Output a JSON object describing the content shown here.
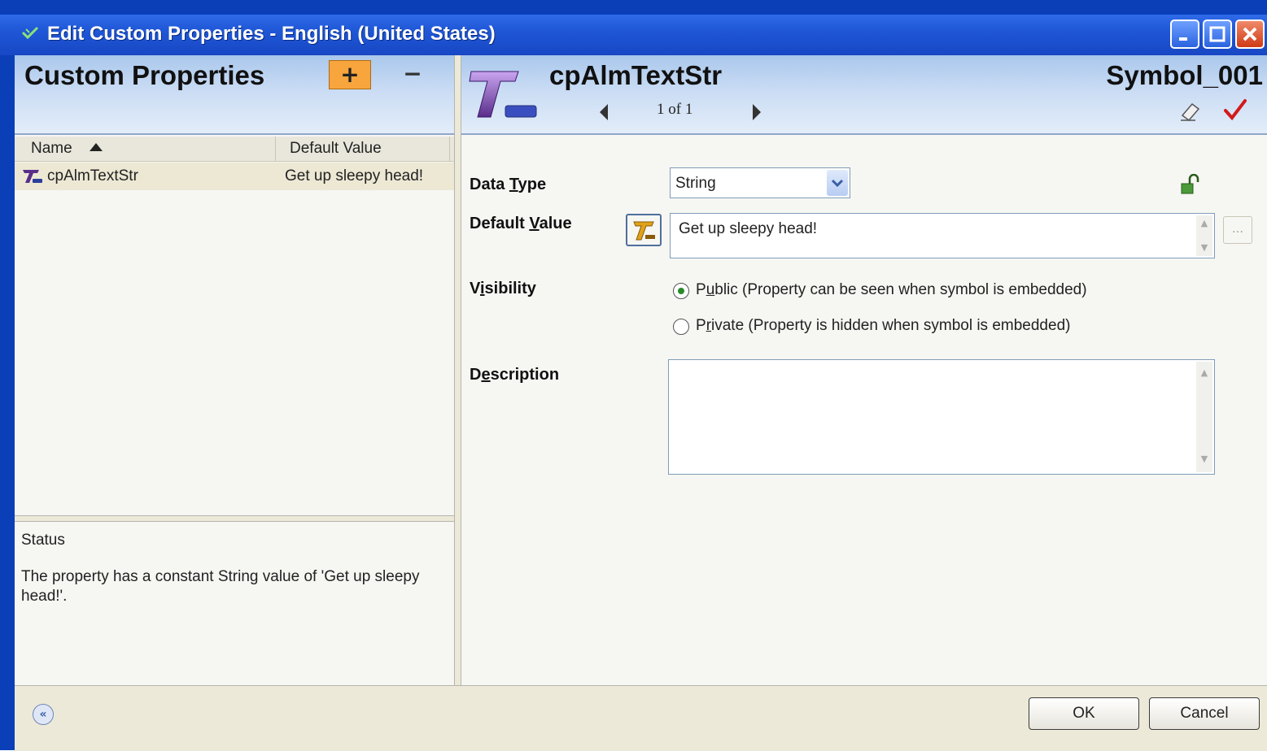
{
  "window": {
    "title": "Edit Custom Properties - English (United States)"
  },
  "left_panel": {
    "title": "Custom Properties",
    "add_label": "+",
    "remove_label": "−",
    "columns": {
      "name": "Name",
      "default_value": "Default Value"
    },
    "rows": [
      {
        "name": "cpAlmTextStr",
        "default_value": "Get up sleepy head!"
      }
    ],
    "status": {
      "title": "Status",
      "message": "The property has a constant String value of 'Get up sleepy head!'."
    }
  },
  "right_panel": {
    "property_name": "cpAlmTextStr",
    "navigation": "1 of 1",
    "symbol_name": "Symbol_001",
    "data_type": {
      "label_pre": "Data ",
      "label_key": "T",
      "label_post": "ype",
      "value": "String"
    },
    "default_value": {
      "label_pre": "Default ",
      "label_key": "V",
      "label_post": "alue",
      "value": "Get up sleepy head!"
    },
    "visibility": {
      "label_pre": "V",
      "label_key": "i",
      "label_post": "sibility",
      "options": [
        {
          "pre": "P",
          "key": "u",
          "post": "blic (Property can be seen when symbol is embedded)",
          "selected": true
        },
        {
          "pre": "P",
          "key": "r",
          "post": "ivate (Property is hidden when symbol is embedded)",
          "selected": false
        }
      ]
    },
    "description": {
      "label_pre": "D",
      "label_key": "e",
      "label_post": "scription",
      "value": ""
    }
  },
  "footer": {
    "ok_label": "OK",
    "cancel_label": "Cancel"
  },
  "icons": {
    "title": "check-arrows-icon",
    "collapse": "double-chevron-left-icon",
    "lock": "unlocked-padlock-icon",
    "check": "red-checkmark-icon",
    "eraser": "eraser-icon"
  },
  "colors": {
    "titlebar": "#1f57d6",
    "header_gradient": "#a9c7ec",
    "add_button": "#f7a53c",
    "check": "#d21a1a",
    "radio_selected": "#2a8a2a"
  }
}
